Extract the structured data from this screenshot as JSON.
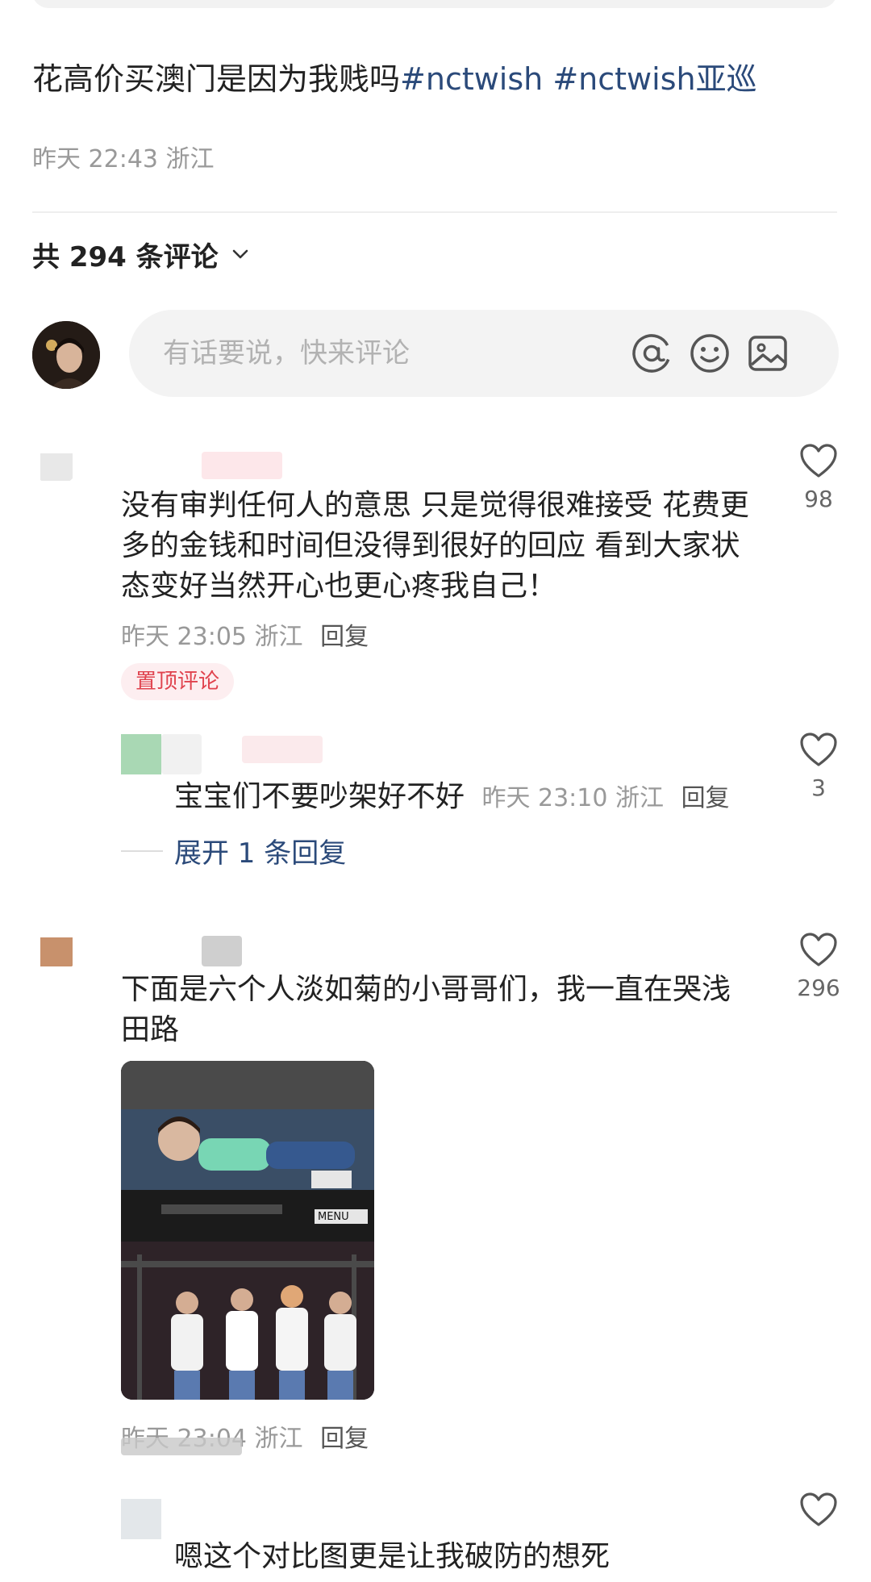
{
  "post": {
    "text": "花高价买澳门是因为我贱吗",
    "tags": [
      "#nctwish",
      "#nctwish亚巡"
    ],
    "time": "昨天 22:43",
    "location": "浙江"
  },
  "comments_header": {
    "label": "共 294 条评论"
  },
  "input": {
    "placeholder": "有话要说，快来评论"
  },
  "comments": [
    {
      "text": "没有审判任何人的意思 只是觉得很难接受 花费更多的金钱和时间但没得到很好的回应 看到大家状态变好当然开心也更心疼我自己！",
      "time": "昨天 23:05",
      "location": "浙江",
      "reply_label": "回复",
      "badge": "置顶评论",
      "likes": "98",
      "sub_reply": {
        "text": "宝宝们不要吵架好不好",
        "time": "昨天 23:10",
        "location": "浙江",
        "reply_label": "回复",
        "likes": "3"
      },
      "expand_label": "展开 1 条回复"
    },
    {
      "text": "下面是六个人淡如菊的小哥哥们，我一直在哭浅田路",
      "time": "昨天 23:04",
      "location": "浙江",
      "reply_label": "回复",
      "likes": "296",
      "image_caption": "MENU"
    },
    {
      "text": "嗯这个对比图更是让我破防的想死"
    }
  ],
  "colors": {
    "link": "#2b4a7a",
    "badge_bg": "#fdeef0",
    "badge_text": "#e0434e",
    "meta": "#999999"
  },
  "icons": [
    "chevron-down-icon",
    "at-icon",
    "emoji-icon",
    "image-icon",
    "heart-icon"
  ]
}
